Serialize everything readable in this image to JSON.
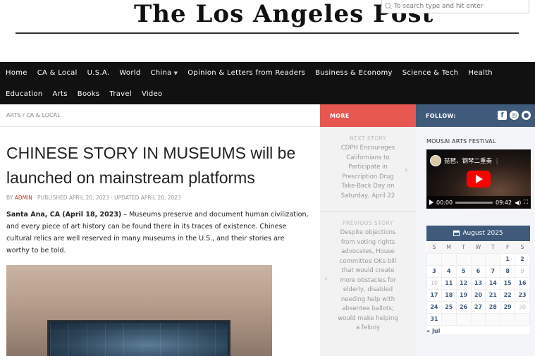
{
  "masthead": {
    "title": "The Los Angeles Post",
    "search_placeholder": "To search type and hit enter"
  },
  "nav": {
    "row1": [
      "Home",
      "CA & Local",
      "U.S.A.",
      "World",
      "China",
      "Opinion & Letters from Readers",
      "Business & Economy",
      "Science & Tech",
      "Health"
    ],
    "row2": [
      "Education",
      "Arts",
      "Books",
      "Travel",
      "Video"
    ]
  },
  "breadcrumb": {
    "section": "ARTS",
    "separator": " / ",
    "subsection": "CA & LOCAL"
  },
  "article": {
    "headline": "CHINESE STORY IN MUSEUMS will be launched on mainstream platforms",
    "byline_prefix": "BY ",
    "author": "ADMIN",
    "byline_dates": " · PUBLISHED APRIL 20, 2023 · UPDATED APRIL 20, 2023",
    "lead_bold": "Santa Ana, CA (April 18, 2023)",
    "lead_text": " – Museums preserve and document human civilization, and every piece of art history can be found there in its traces of existence. Chinese cultural relics are well reserved in many museums in the U.S., and their stories are worthy to be told."
  },
  "more": {
    "label": "MORE",
    "next_kicker": "NEXT STORY",
    "next_text": "CDPH Encourages Californians to Participate in Prescription Drug Take-Back Day on Saturday, April 22",
    "prev_kicker": "PREVIOUS STORY",
    "prev_text": "Despite objections from voting rights advocates, House committee OKs bill that would create more obstacles for elderly, disabled needing help with absentee ballots; would make helping a felony",
    "arrow_right": "›",
    "arrow_left": "‹"
  },
  "sidebar": {
    "follow_label": "FOLLOW:",
    "social": [
      "f",
      "◎",
      "●"
    ],
    "festival_title": "MOUSAI ARTS FESTIVAL",
    "video": {
      "title": "琵琶、钢琴二重奏 ⋮",
      "current_time": "00:00",
      "duration": "09:42",
      "volume": "◀)",
      "fullscreen": "⛶"
    },
    "calendar": {
      "month": "August 2025",
      "weekdays": [
        "S",
        "M",
        "T",
        "W",
        "T",
        "F",
        "S"
      ],
      "weeks": [
        [
          "",
          "",
          "",
          "",
          "",
          "1",
          "2"
        ],
        [
          "3",
          "4",
          "5",
          "6",
          "7",
          "8",
          "9"
        ],
        [
          "10",
          "11",
          "12",
          "13",
          "14",
          "15",
          "16"
        ],
        [
          "17",
          "18",
          "19",
          "20",
          "21",
          "22",
          "23"
        ],
        [
          "24",
          "25",
          "26",
          "27",
          "28",
          "29",
          "30"
        ],
        [
          "31",
          "",
          "",
          "",
          "",
          "",
          ""
        ]
      ],
      "muted_days": [
        "9",
        "10",
        "30"
      ],
      "prev_link": "« Jul"
    }
  },
  "colors": {
    "nav_bg": "#111111",
    "more_accent": "#e6574f",
    "follow_accent": "#3f5a7a",
    "author_link": "#c0392b"
  }
}
